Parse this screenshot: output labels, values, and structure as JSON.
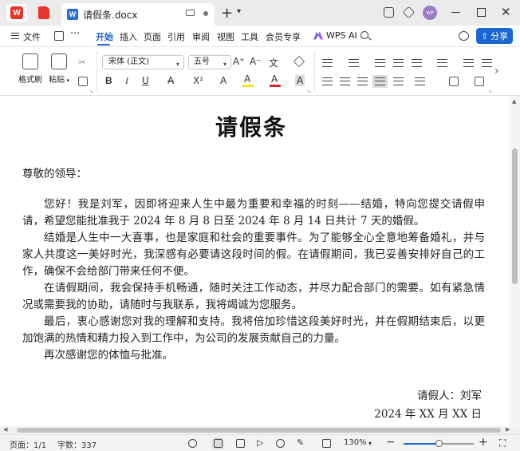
{
  "titlebar": {
    "doc_tab_name": "请假条.docx",
    "doc_icon_letter": "W",
    "app_logo_letter": "W",
    "avatar_initials": "WP",
    "new_tab": "+"
  },
  "menubar": {
    "file": "文件",
    "items": [
      "开始",
      "插入",
      "页面",
      "引用",
      "审阅",
      "视图",
      "工具",
      "会员专享"
    ],
    "active_item": "开始",
    "wps_ai": "WPS AI",
    "share": "分享"
  },
  "ribbon": {
    "format_painter": "格式刷",
    "paste": "粘贴",
    "font_name": "宋体 (正文)",
    "font_size": "五号",
    "bold": "B",
    "italic": "I",
    "underline": "U",
    "strikethrough": "A",
    "superscript": "X²",
    "font_effect": "A",
    "highlight": "A",
    "font_color": "A",
    "char_shading": "A",
    "grow_font": "A⁺",
    "shrink_font": "A⁻",
    "phonetic": "文",
    "highlight_color": "#f5e71a",
    "font_color_value": "#d62828",
    "accent_color": "#1a66d2"
  },
  "document": {
    "title": "请假条",
    "greeting": "尊敬的领导：",
    "paragraphs": [
      "您好！我是刘军，因即将迎来人生中最为重要和幸福的时刻——结婚，特向您提交请假申请，希望您能批准我于 2024 年 8 月 8 日至 2024 年 8 月 14 日共计 7 天的婚假。",
      "结婚是人生中一大喜事，也是家庭和社会的重要事件。为了能够全心全意地筹备婚礼，并与家人共度这一美好时光，我深感有必要请这段时间的假。在请假期间，我已妥善安排好自己的工作，确保不会给部门带来任何不便。",
      "在请假期间，我会保持手机畅通，随时关注工作动态，并尽力配合部门的需要。如有紧急情况或需要我的协助，请随时与我联系，我将竭诚为您服务。",
      "最后，衷心感谢您对我的理解和支持。我将倍加珍惜这段美好时光，并在假期结束后，以更加饱满的热情和精力投入到工作中，为公司的发展贡献自己的力量。",
      "再次感谢您的体恤与批准。"
    ],
    "signature": "请假人：刘军",
    "date": "2024 年 XX 月 XX 日"
  },
  "statusbar": {
    "page": "页面：1/1",
    "word_count": "字数：337",
    "zoom": "130%",
    "zoom_fraction": 0.5,
    "zoom_minus": "−",
    "zoom_plus": "+"
  }
}
